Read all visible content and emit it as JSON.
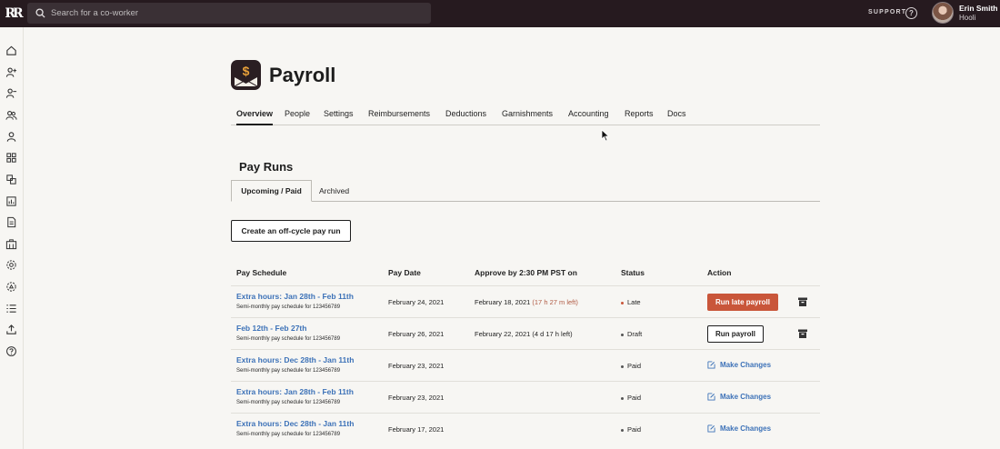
{
  "topbar": {
    "logo": "RR",
    "search_placeholder": "Search for a co-worker",
    "support_label": "SUPPORT",
    "help_glyph": "?",
    "user_name": "Erin Smith",
    "user_org": "Hooli"
  },
  "sidenav": {
    "icons": [
      "home-icon",
      "person-add-icon",
      "person-remove-icon",
      "people-icon",
      "person-icon",
      "apps-grid-icon",
      "layers-icon",
      "chart-icon",
      "document-icon",
      "building-icon",
      "settings-icon",
      "settings-alt-icon",
      "list-icon",
      "upload-icon",
      "help-icon"
    ]
  },
  "app": {
    "icon_glyph": "$",
    "title": "Payroll",
    "accent": "#e8a13a"
  },
  "tabs": [
    {
      "label": "Overview"
    },
    {
      "label": "People"
    },
    {
      "label": "Settings"
    },
    {
      "label": "Reimbursements"
    },
    {
      "label": "Deductions"
    },
    {
      "label": "Garnishments"
    },
    {
      "label": "Accounting"
    },
    {
      "label": "Reports"
    },
    {
      "label": "Docs"
    }
  ],
  "pay_runs": {
    "title": "Pay Runs",
    "subtabs": [
      "Upcoming / Paid",
      "Archived"
    ],
    "create_button": "Create an off-cycle pay run",
    "columns": [
      "Pay Schedule",
      "Pay Date",
      "Approve by 2:30 PM PST on",
      "Status",
      "Action"
    ],
    "rows": [
      {
        "schedule": "Extra hours: Jan 28th - Feb 11th",
        "subtitle": "Semi-monthly pay schedule for 123456789",
        "pay_date": "February 24, 2021",
        "approve_by": "February 18, 2021",
        "time_left": "(17 h 27 m left)",
        "status": "Late",
        "status_color": "#c9563a",
        "action": "Run late payroll"
      },
      {
        "schedule": "Feb 12th - Feb 27th",
        "subtitle": "Semi-monthly pay schedule for 123456789",
        "pay_date": "February 26, 2021",
        "approve_by": "February 22, 2021 (4 d 17 h left)",
        "time_left": "",
        "status": "Draft",
        "status_color": "#555555",
        "action": "Run payroll"
      },
      {
        "schedule": "Extra hours: Dec 28th - Jan 11th",
        "subtitle": "Semi-monthly pay schedule for 123456789",
        "pay_date": "February 23, 2021",
        "approve_by": "",
        "time_left": "",
        "status": "Paid",
        "status_color": "#555555",
        "action": "Make Changes"
      },
      {
        "schedule": "Extra hours: Jan 28th - Feb 11th",
        "subtitle": "Semi-monthly pay schedule for 123456789",
        "pay_date": "February 23, 2021",
        "approve_by": "",
        "time_left": "",
        "status": "Paid",
        "status_color": "#555555",
        "action": "Make Changes"
      },
      {
        "schedule": "Extra hours: Dec 28th - Jan 11th",
        "subtitle": "Semi-monthly pay schedule for 123456789",
        "pay_date": "February 17, 2021",
        "approve_by": "",
        "time_left": "",
        "status": "Paid",
        "status_color": "#555555",
        "action": "Make Changes"
      }
    ]
  }
}
